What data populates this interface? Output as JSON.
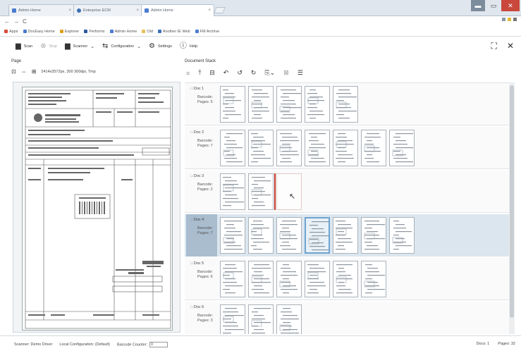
{
  "browser": {
    "tabs": [
      {
        "label": "Admin Home"
      },
      {
        "label": "Enterprise ECM"
      },
      {
        "label": "Admin Home"
      }
    ],
    "bookmarks": [
      "Apps",
      "DocEasy Home",
      "Explorer",
      "Performs",
      "Admin Home",
      "Old",
      "Another IE Web",
      "FM Archive"
    ]
  },
  "toolbar": {
    "scan": "Scan",
    "stop": "Stop",
    "scanner": "Scanner",
    "configuration": "Configuration",
    "settings": "Settings",
    "help": "Help"
  },
  "page_panel": {
    "title": "Page",
    "meta": "2414x3572px, 300 300dpi, Tmp"
  },
  "stack_panel": {
    "title": "Document Stack",
    "documents": [
      {
        "name": "Doc 1",
        "barcode": "Barcode:",
        "pages": "Pages: 5"
      },
      {
        "name": "Doc 2",
        "barcode": "Barcode:",
        "pages": "Pages: 7"
      },
      {
        "name": "Doc 3",
        "barcode": "Barcode:",
        "pages": "Pages: 2"
      },
      {
        "name": "Doc 4",
        "barcode": "Barcode:",
        "pages": "Pages: 7"
      },
      {
        "name": "Doc 5",
        "barcode": "Barcode:",
        "pages": "Pages: 6"
      },
      {
        "name": "Doc 6",
        "barcode": "Barcode:",
        "pages": "Pages: 3"
      }
    ]
  },
  "status": {
    "scanner": "Scanner: Demo Driver",
    "config": "Local Configuration: (Default)",
    "counter_label": "Barcode Counter:",
    "counter_value": "0",
    "docs": "Docs: 1",
    "pages": "Pages: 32"
  }
}
